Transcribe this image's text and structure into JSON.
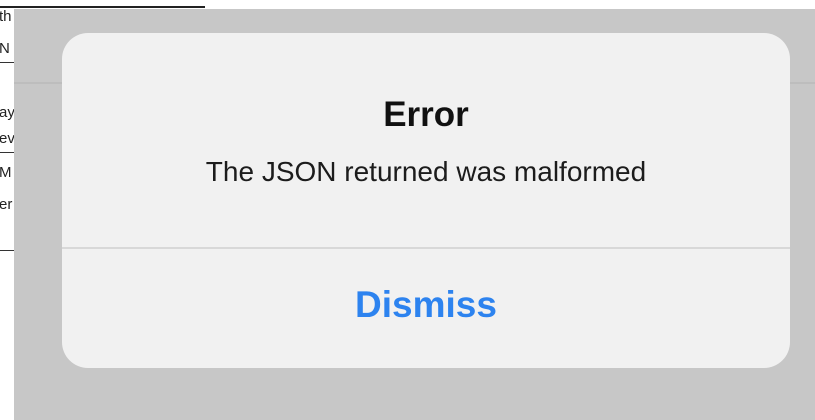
{
  "background_page": {
    "fragments": [
      "th",
      "N",
      "ay",
      "ev",
      "M",
      "er"
    ]
  },
  "alert": {
    "title": "Error",
    "message": "The JSON returned was malformed",
    "dismiss_label": "Dismiss"
  },
  "colors": {
    "overlay": "#c7c7c7",
    "alert_background": "#f1f1f1",
    "button_text": "#2d83ef",
    "title_text": "#111111"
  }
}
